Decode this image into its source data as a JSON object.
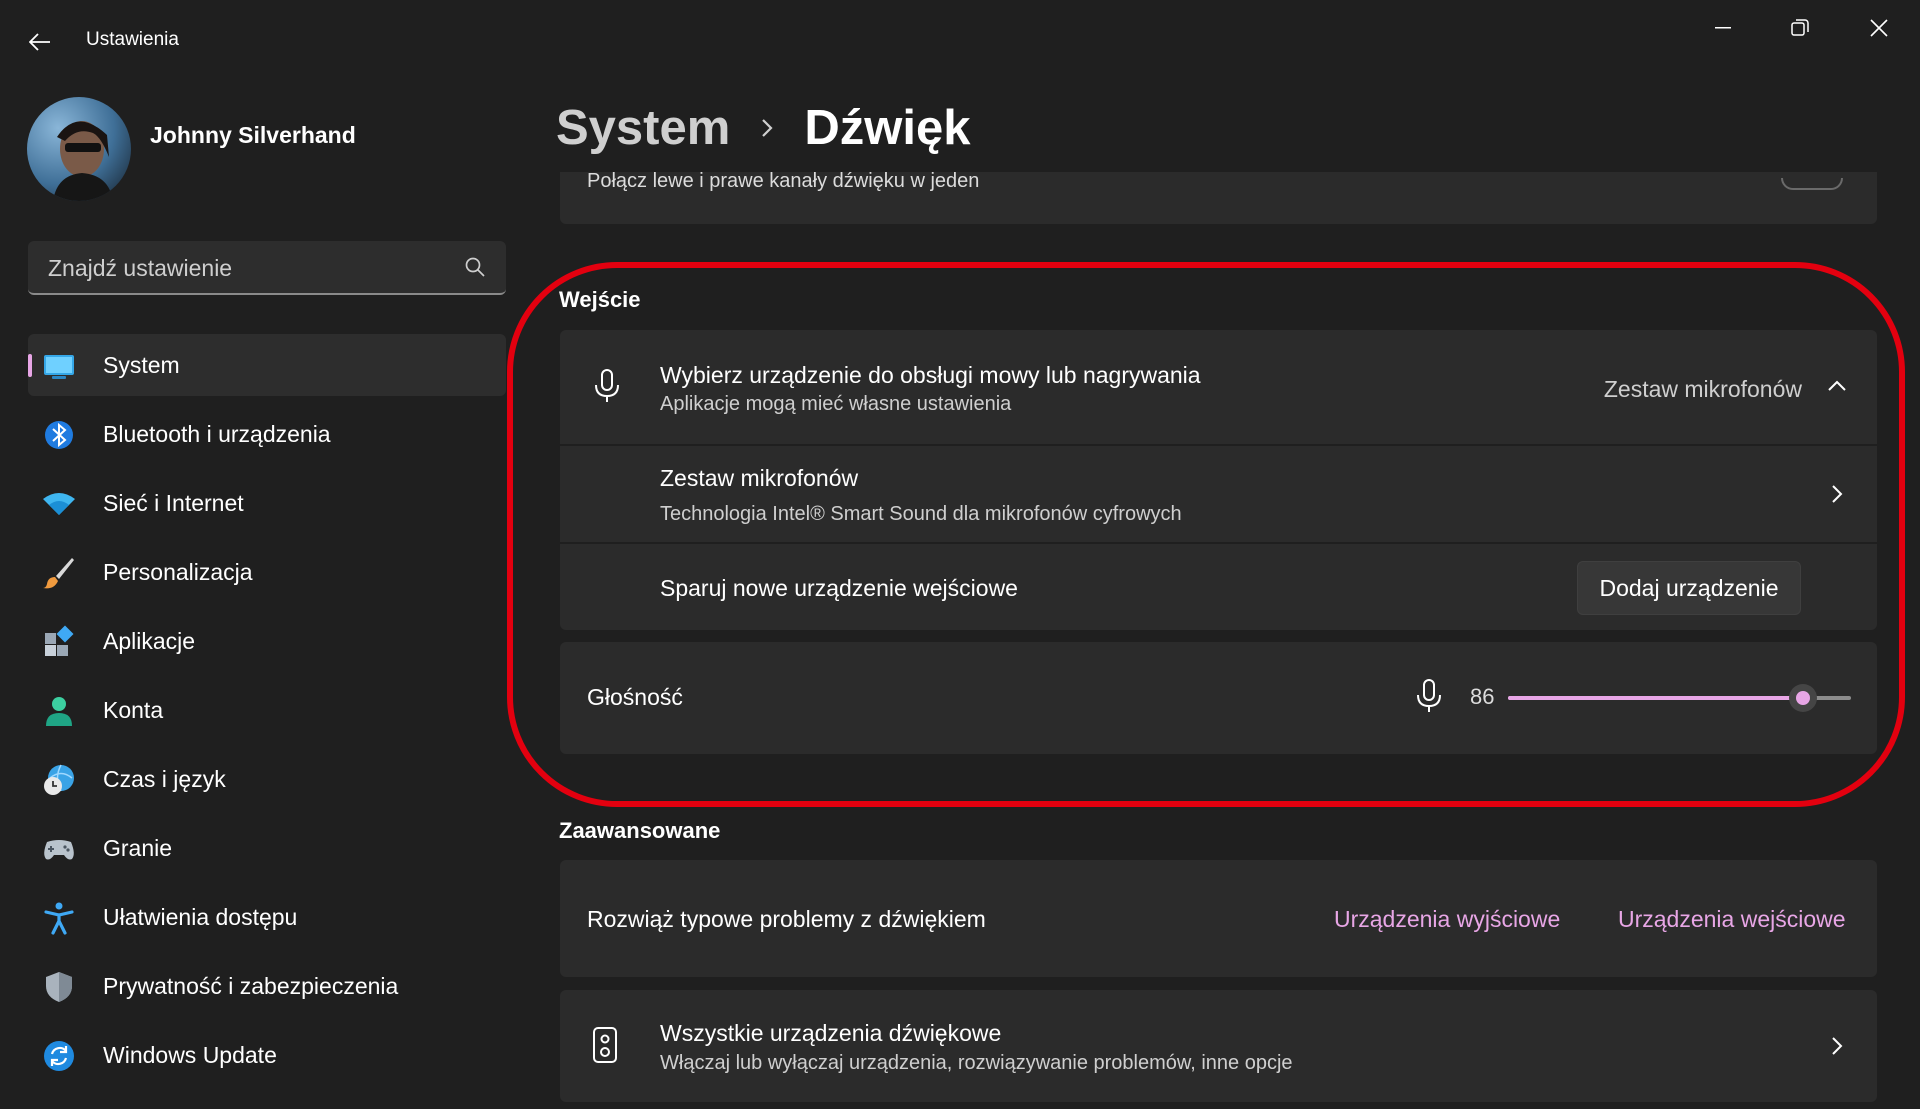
{
  "window": {
    "title": "Ustawienia"
  },
  "user": {
    "name": "Johnny Silverhand"
  },
  "search": {
    "placeholder": "Znajdź ustawienie"
  },
  "nav": [
    {
      "label": "System",
      "icon": "system-icon",
      "active": true
    },
    {
      "label": "Bluetooth i urządzenia",
      "icon": "bluetooth-icon"
    },
    {
      "label": "Sieć i Internet",
      "icon": "wifi-icon"
    },
    {
      "label": "Personalizacja",
      "icon": "brush-icon"
    },
    {
      "label": "Aplikacje",
      "icon": "apps-icon"
    },
    {
      "label": "Konta",
      "icon": "account-icon"
    },
    {
      "label": "Czas i język",
      "icon": "time-language-icon"
    },
    {
      "label": "Granie",
      "icon": "gamepad-icon"
    },
    {
      "label": "Ułatwienia dostępu",
      "icon": "accessibility-icon"
    },
    {
      "label": "Prywatność i zabezpieczenia",
      "icon": "shield-icon"
    },
    {
      "label": "Windows Update",
      "icon": "update-icon"
    }
  ],
  "breadcrumb": {
    "parent": "System",
    "current": "Dźwięk"
  },
  "mono_audio": {
    "description": "Połącz lewe i prawe kanały dźwięku w jeden"
  },
  "input_section": {
    "title": "Wejście",
    "choose_device": {
      "title": "Wybierz urządzenie do obsługi mowy lub nagrywania",
      "subtitle": "Aplikacje mogą mieć własne ustawienia",
      "selected": "Zestaw mikrofonów"
    },
    "device": {
      "title": "Zestaw mikrofonów",
      "subtitle": "Technologia Intel® Smart Sound dla mikrofonów cyfrowych"
    },
    "pair": {
      "title": "Sparuj nowe urządzenie wejściowe",
      "button": "Dodaj urządzenie"
    },
    "volume": {
      "label": "Głośność",
      "value": "86",
      "level": 0.86
    }
  },
  "advanced_section": {
    "title": "Zaawansowane",
    "troubleshoot": {
      "text": "Rozwiąż typowe problemy z dźwiękiem",
      "output_link": "Urządzenia wyjściowe",
      "input_link": "Urządzenia wejściowe"
    },
    "all_devices": {
      "title": "Wszystkie urządzenia dźwiękowe",
      "subtitle": "Włączaj lub wyłączaj urządzenia, rozwiązywanie problemów, inne opcje"
    }
  },
  "colors": {
    "accent": "#e8a6e6",
    "highlight": "#e3000f",
    "background": "#1f1f1f",
    "card": "#2b2b2b"
  }
}
